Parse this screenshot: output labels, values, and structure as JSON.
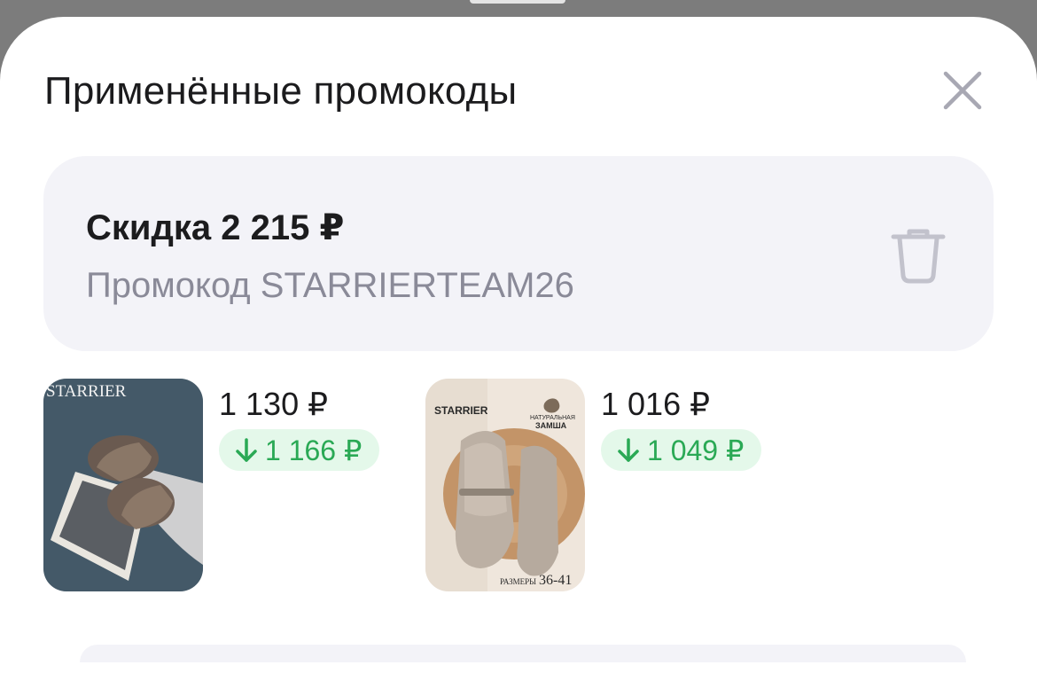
{
  "sheet": {
    "title": "Применённые промокоды",
    "close_icon": "close-icon"
  },
  "promo": {
    "discount": "Скидка 2 215 ₽",
    "code": "Промокод STARRIERTEAM26",
    "delete_icon": "trash-icon"
  },
  "products": [
    {
      "brand": "STARRIER",
      "price": "1 130 ₽",
      "old_price": "1 166 ₽"
    },
    {
      "brand": "STARRIER",
      "badge_line1": "НАТУРАЛЬНАЯ",
      "badge_line2": "ЗАМША",
      "sizes_label": "РАЗМЕРЫ",
      "sizes_range": "36-41",
      "price": "1 016 ₽",
      "old_price": "1 049 ₽"
    }
  ],
  "colors": {
    "accent_green": "#2aa955",
    "badge_green_bg": "#e4f8ea",
    "card_bg": "#f3f3f8",
    "secondary_text": "#8a8a98"
  }
}
